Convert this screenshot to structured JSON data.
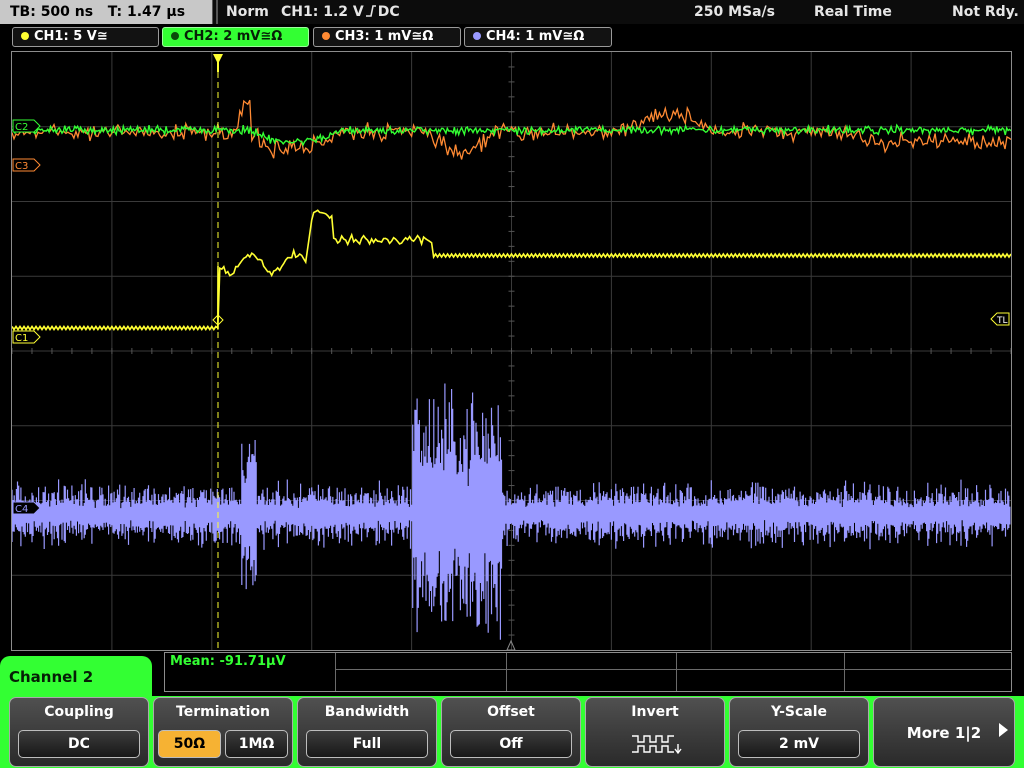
{
  "topbar": {
    "timebase": "TB: 500 ns",
    "trigger_time": "T: 1.47 µs",
    "mode": "Norm",
    "trigger_setting": "CH1: 1.2 V",
    "trigger_edge_icon": "rising-edge-icon",
    "trigger_coupling": "DC",
    "sample_rate": "250 MSa/s",
    "acq_mode": "Real Time",
    "status": "Not Rdy."
  },
  "channels": [
    {
      "id": "ch1",
      "label": "CH1: 5 V≅",
      "color": "#ffff33"
    },
    {
      "id": "ch2",
      "label": "CH2: 2 mV≅Ω",
      "color": "#33ff33",
      "active": true
    },
    {
      "id": "ch3",
      "label": "CH3: 1 mV≅Ω",
      "color": "#ff8a33"
    },
    {
      "id": "ch4",
      "label": "CH4: 1 mV≅Ω",
      "color": "#9999ff"
    }
  ],
  "markers": {
    "c3": "C3",
    "c1": "C1",
    "c4": "C4",
    "c2": "C2",
    "trigger_level": "TL",
    "trigger_position_icon": "trigger-position-icon"
  },
  "measurement": {
    "text": "Mean: -91.71µV",
    "color": "#33ff33"
  },
  "menu": {
    "title": "Channel 2"
  },
  "softkeys": {
    "coupling": {
      "title": "Coupling",
      "value": "DC"
    },
    "termination": {
      "title": "Termination",
      "opt_a": "50Ω",
      "opt_b": "1MΩ",
      "selected": "50Ω"
    },
    "bandwidth": {
      "title": "Bandwidth",
      "value": "Full"
    },
    "offset": {
      "title": "Offset",
      "value": "Off"
    },
    "invert": {
      "title": "Invert",
      "icon": "invert-square-wave-icon"
    },
    "yscale": {
      "title": "Y-Scale",
      "value": "2 mV"
    },
    "more": {
      "title": "More 1|2",
      "icon": "next-page-arrow-icon"
    }
  },
  "colors": {
    "ch1": "#ffff33",
    "ch2": "#33ff33",
    "ch3": "#ff8a33",
    "ch4": "#9999ff",
    "grid": "#3a3a3a",
    "softkey_band": "#33ff33",
    "selected_option": "#f6b233"
  }
}
